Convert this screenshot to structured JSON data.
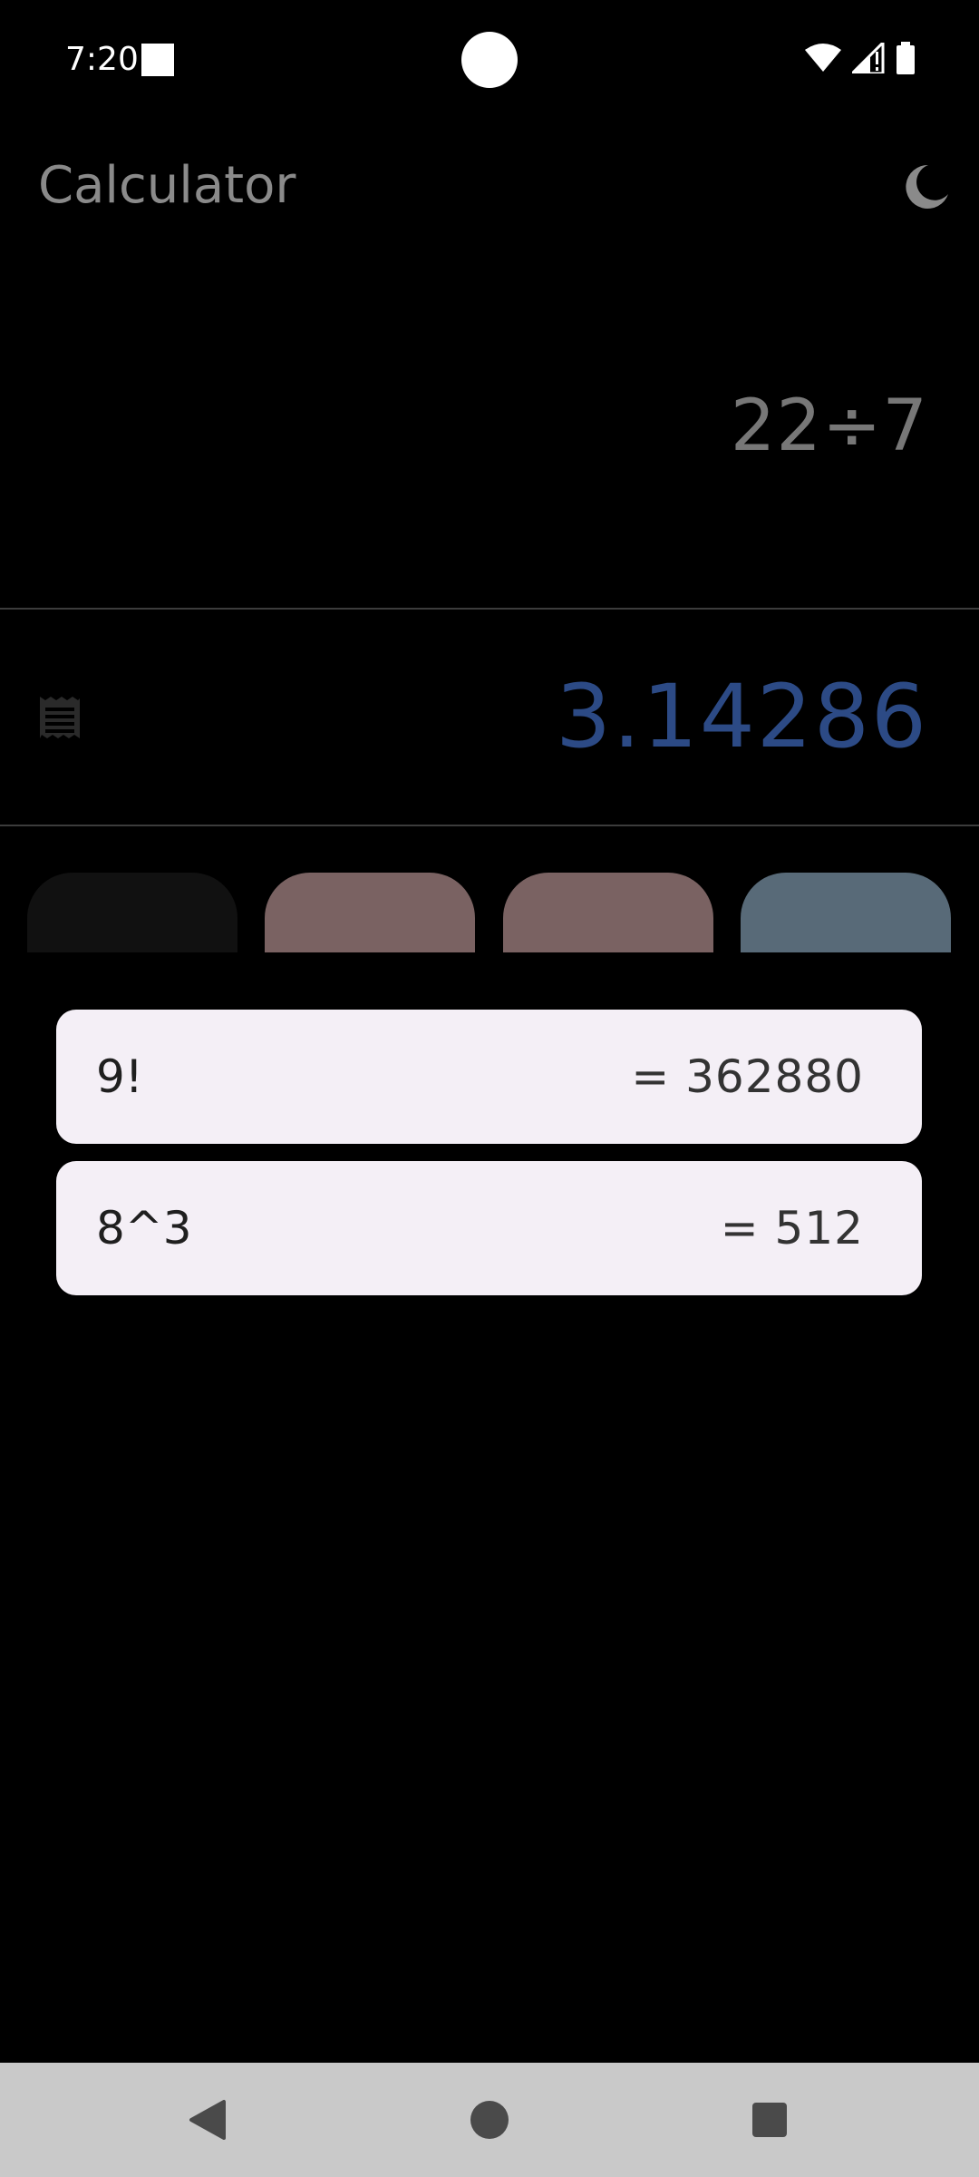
{
  "status_bar": {
    "time": "7:20",
    "icons": [
      "notification-square-icon",
      "wifi-icon",
      "signal-icon",
      "battery-icon"
    ]
  },
  "app_bar": {
    "title": "Calculator",
    "theme_icon": "moon-icon"
  },
  "display": {
    "expression": "22÷7",
    "result": "3.14286",
    "history_icon": "history-receipt-icon"
  },
  "colors": {
    "background": "#000000",
    "result": "#2c4a85",
    "expression": "#777777",
    "card_bg": "#f4eff6",
    "nav_bar": "#c9c9c9",
    "key_operator": "#7a6262",
    "key_accent": "#586a78"
  },
  "history": {
    "items": [
      {
        "expression": "9!",
        "result": "= 362880"
      },
      {
        "expression": "8^3",
        "result": "= 512"
      }
    ]
  },
  "nav_bar": {
    "icons": [
      "back-icon",
      "home-icon",
      "recents-icon"
    ]
  }
}
